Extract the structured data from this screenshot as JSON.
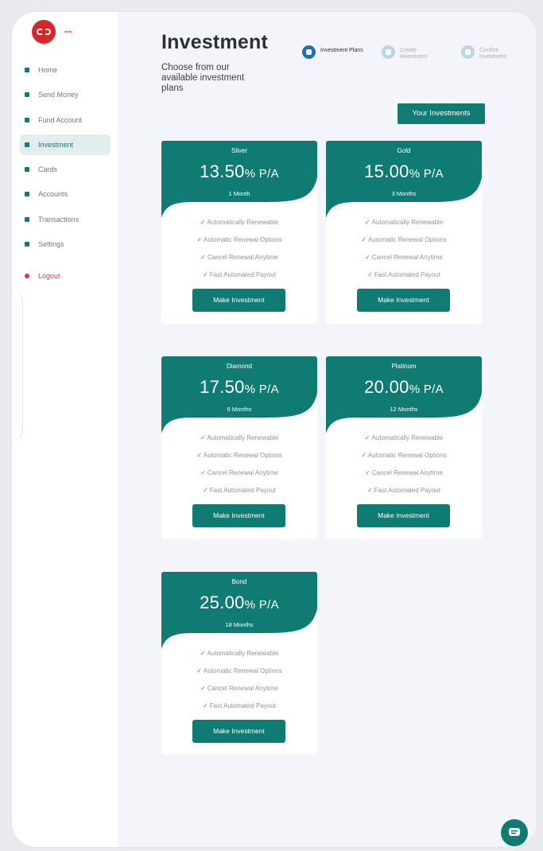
{
  "sidebar": {
    "brand_text": "wells",
    "items": [
      {
        "label": "Home",
        "icon": "home-icon"
      },
      {
        "label": "Send Money",
        "icon": "send-money-icon"
      },
      {
        "label": "Fund Account",
        "icon": "fund-icon"
      },
      {
        "label": "Investment",
        "icon": "chart-icon",
        "active": true
      },
      {
        "label": "Cards",
        "icon": "card-icon"
      },
      {
        "label": "Accounts",
        "icon": "bank-icon"
      },
      {
        "label": "Transactions",
        "icon": "receipt-icon"
      },
      {
        "label": "Settings",
        "icon": "gear-icon"
      }
    ],
    "logout": {
      "label": "Logout",
      "icon": "power-icon"
    }
  },
  "header": {
    "title": "Investment",
    "subtitle": "Choose from our available investment plans"
  },
  "steps": [
    {
      "label": "Investment Plans",
      "active": true
    },
    {
      "label": "Create Investment",
      "active": false
    },
    {
      "label": "Confirm Investment",
      "active": false
    }
  ],
  "your_investments_label": "Your Investments",
  "plans": [
    {
      "name": "Silver",
      "rate": "13.50",
      "unit": "% P/A",
      "duration": "1 Month"
    },
    {
      "name": "Gold",
      "rate": "15.00",
      "unit": "% P/A",
      "duration": "3 Months"
    },
    {
      "name": "Diamond",
      "rate": "17.50",
      "unit": "% P/A",
      "duration": "6 Months"
    },
    {
      "name": "Platinum",
      "rate": "20.00",
      "unit": "% P/A",
      "duration": "12 Months"
    },
    {
      "name": "Bond",
      "rate": "25.00",
      "unit": "% P/A",
      "duration": "18 Months"
    }
  ],
  "features": [
    "Automatically Renewable",
    "Automatic Renewal Options",
    "Cancel Renewal Anytime",
    "Fast Automated Payout"
  ],
  "cta_label": "Make Investment",
  "colors": {
    "brand": "#0f7b73",
    "accent_red": "#d8272c",
    "step_active": "#1c6fb8"
  }
}
